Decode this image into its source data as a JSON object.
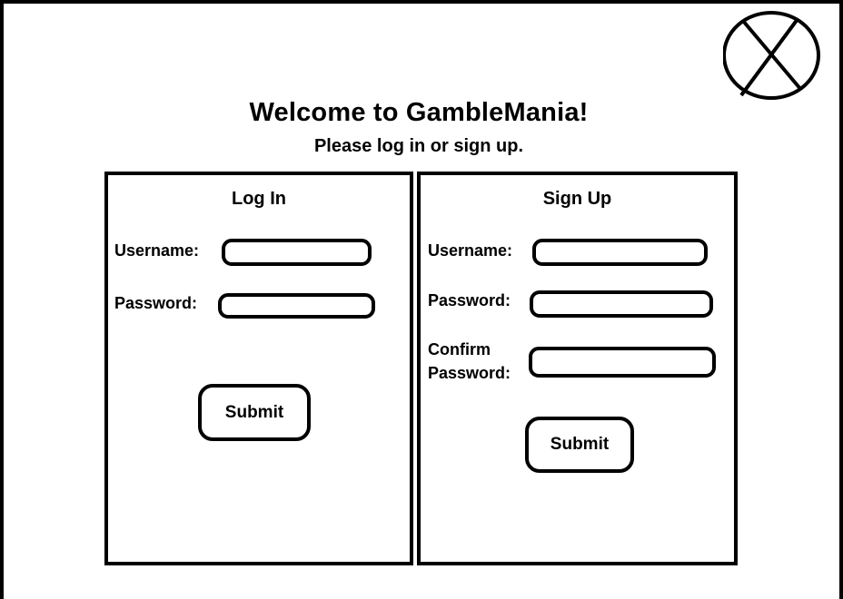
{
  "header": {
    "title": "Welcome to GambleMania!",
    "subtitle": "Please log in or sign up."
  },
  "close_button": {
    "icon": "close-icon"
  },
  "login": {
    "title": "Log In",
    "username_label": "Username:",
    "password_label": "Password:",
    "username_value": "",
    "password_value": "",
    "submit_label": "Submit"
  },
  "signup": {
    "title": "Sign Up",
    "username_label": "Username:",
    "password_label": "Password:",
    "confirm_label_line1": "Confirm",
    "confirm_label_line2": "Password:",
    "username_value": "",
    "password_value": "",
    "confirm_value": "",
    "submit_label": "Submit"
  },
  "colors": {
    "ink": "#000000",
    "background": "#ffffff"
  }
}
